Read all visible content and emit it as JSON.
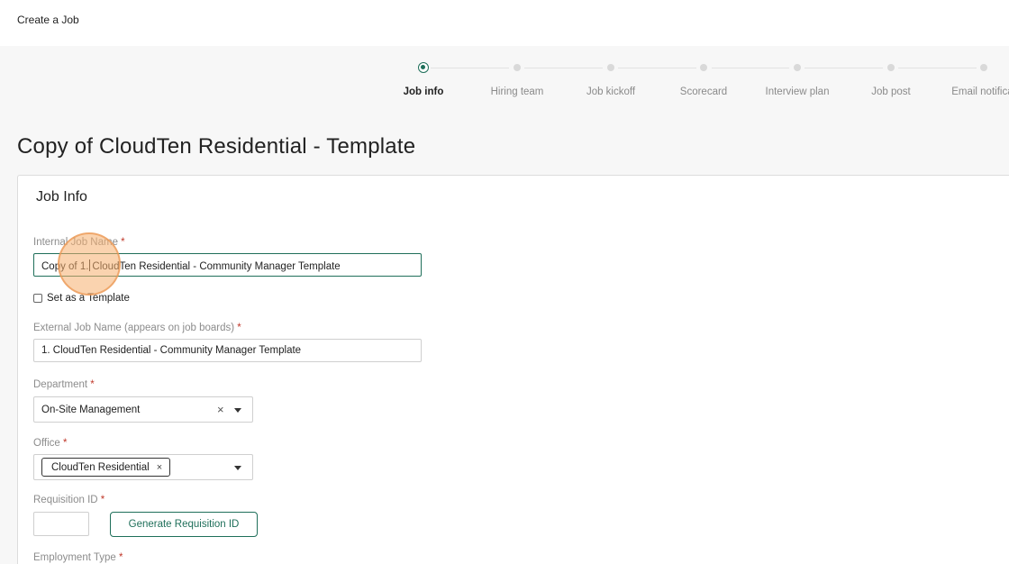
{
  "header": {
    "title": "Create a Job"
  },
  "stepper": {
    "steps": [
      {
        "label": "Job info",
        "active": true
      },
      {
        "label": "Hiring team",
        "active": false
      },
      {
        "label": "Job kickoff",
        "active": false
      },
      {
        "label": "Scorecard",
        "active": false
      },
      {
        "label": "Interview plan",
        "active": false
      },
      {
        "label": "Job post",
        "active": false
      },
      {
        "label": "Email notificat",
        "active": false
      }
    ]
  },
  "page": {
    "title": "Copy of CloudTen Residential - Template"
  },
  "job_info": {
    "section_title": "Job Info",
    "internal_job_name": {
      "label": "Internal Job Name",
      "required": "*",
      "value_before_caret": "Copy of 1.",
      "value_after_caret": "CloudTen Residential - Community Manager Template"
    },
    "set_as_template": {
      "label": "Set as a Template",
      "checked": false
    },
    "external_job_name": {
      "label": "External Job Name (appears on job boards)",
      "required": "*",
      "value": "1. CloudTen Residential - Community Manager Template"
    },
    "department": {
      "label": "Department",
      "required": "*",
      "value": "On-Site Management",
      "clear_glyph": "×"
    },
    "office": {
      "label": "Office",
      "required": "*",
      "chip": "CloudTen Residential",
      "chip_remove_glyph": "×"
    },
    "requisition_id": {
      "label": "Requisition ID",
      "required": "*",
      "value": "",
      "generate_button": "Generate Requisition ID"
    },
    "employment_type": {
      "label": "Employment Type",
      "required": "*"
    }
  },
  "colors": {
    "accent": "#1f6f5a",
    "required": "#c0392b",
    "click_indicator": "#f5af6e"
  }
}
